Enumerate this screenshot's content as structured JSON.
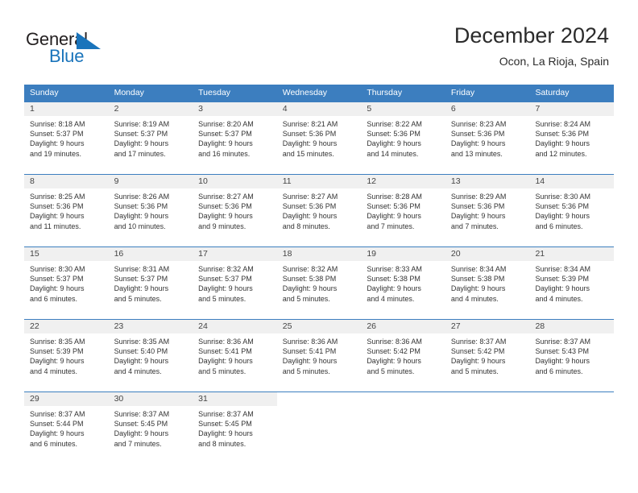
{
  "brand": {
    "name_top": "General",
    "name_bottom": "Blue",
    "flag_icon": "blue-triangle-flag-icon",
    "color_dark": "#231f20",
    "color_blue": "#1a74bb"
  },
  "header": {
    "title": "December 2024",
    "subtitle": "Ocon, La Rioja, Spain"
  },
  "theme": {
    "header_blue": "#3c7ebf",
    "day_band_gray": "#f0f0f0",
    "text_dark": "#333333"
  },
  "weekdays": [
    "Sunday",
    "Monday",
    "Tuesday",
    "Wednesday",
    "Thursday",
    "Friday",
    "Saturday"
  ],
  "weeks": [
    [
      {
        "day": "1",
        "sunrise": "Sunrise: 8:18 AM",
        "sunset": "Sunset: 5:37 PM",
        "daylight1": "Daylight: 9 hours",
        "daylight2": "and 19 minutes."
      },
      {
        "day": "2",
        "sunrise": "Sunrise: 8:19 AM",
        "sunset": "Sunset: 5:37 PM",
        "daylight1": "Daylight: 9 hours",
        "daylight2": "and 17 minutes."
      },
      {
        "day": "3",
        "sunrise": "Sunrise: 8:20 AM",
        "sunset": "Sunset: 5:37 PM",
        "daylight1": "Daylight: 9 hours",
        "daylight2": "and 16 minutes."
      },
      {
        "day": "4",
        "sunrise": "Sunrise: 8:21 AM",
        "sunset": "Sunset: 5:36 PM",
        "daylight1": "Daylight: 9 hours",
        "daylight2": "and 15 minutes."
      },
      {
        "day": "5",
        "sunrise": "Sunrise: 8:22 AM",
        "sunset": "Sunset: 5:36 PM",
        "daylight1": "Daylight: 9 hours",
        "daylight2": "and 14 minutes."
      },
      {
        "day": "6",
        "sunrise": "Sunrise: 8:23 AM",
        "sunset": "Sunset: 5:36 PM",
        "daylight1": "Daylight: 9 hours",
        "daylight2": "and 13 minutes."
      },
      {
        "day": "7",
        "sunrise": "Sunrise: 8:24 AM",
        "sunset": "Sunset: 5:36 PM",
        "daylight1": "Daylight: 9 hours",
        "daylight2": "and 12 minutes."
      }
    ],
    [
      {
        "day": "8",
        "sunrise": "Sunrise: 8:25 AM",
        "sunset": "Sunset: 5:36 PM",
        "daylight1": "Daylight: 9 hours",
        "daylight2": "and 11 minutes."
      },
      {
        "day": "9",
        "sunrise": "Sunrise: 8:26 AM",
        "sunset": "Sunset: 5:36 PM",
        "daylight1": "Daylight: 9 hours",
        "daylight2": "and 10 minutes."
      },
      {
        "day": "10",
        "sunrise": "Sunrise: 8:27 AM",
        "sunset": "Sunset: 5:36 PM",
        "daylight1": "Daylight: 9 hours",
        "daylight2": "and 9 minutes."
      },
      {
        "day": "11",
        "sunrise": "Sunrise: 8:27 AM",
        "sunset": "Sunset: 5:36 PM",
        "daylight1": "Daylight: 9 hours",
        "daylight2": "and 8 minutes."
      },
      {
        "day": "12",
        "sunrise": "Sunrise: 8:28 AM",
        "sunset": "Sunset: 5:36 PM",
        "daylight1": "Daylight: 9 hours",
        "daylight2": "and 7 minutes."
      },
      {
        "day": "13",
        "sunrise": "Sunrise: 8:29 AM",
        "sunset": "Sunset: 5:36 PM",
        "daylight1": "Daylight: 9 hours",
        "daylight2": "and 7 minutes."
      },
      {
        "day": "14",
        "sunrise": "Sunrise: 8:30 AM",
        "sunset": "Sunset: 5:36 PM",
        "daylight1": "Daylight: 9 hours",
        "daylight2": "and 6 minutes."
      }
    ],
    [
      {
        "day": "15",
        "sunrise": "Sunrise: 8:30 AM",
        "sunset": "Sunset: 5:37 PM",
        "daylight1": "Daylight: 9 hours",
        "daylight2": "and 6 minutes."
      },
      {
        "day": "16",
        "sunrise": "Sunrise: 8:31 AM",
        "sunset": "Sunset: 5:37 PM",
        "daylight1": "Daylight: 9 hours",
        "daylight2": "and 5 minutes."
      },
      {
        "day": "17",
        "sunrise": "Sunrise: 8:32 AM",
        "sunset": "Sunset: 5:37 PM",
        "daylight1": "Daylight: 9 hours",
        "daylight2": "and 5 minutes."
      },
      {
        "day": "18",
        "sunrise": "Sunrise: 8:32 AM",
        "sunset": "Sunset: 5:38 PM",
        "daylight1": "Daylight: 9 hours",
        "daylight2": "and 5 minutes."
      },
      {
        "day": "19",
        "sunrise": "Sunrise: 8:33 AM",
        "sunset": "Sunset: 5:38 PM",
        "daylight1": "Daylight: 9 hours",
        "daylight2": "and 4 minutes."
      },
      {
        "day": "20",
        "sunrise": "Sunrise: 8:34 AM",
        "sunset": "Sunset: 5:38 PM",
        "daylight1": "Daylight: 9 hours",
        "daylight2": "and 4 minutes."
      },
      {
        "day": "21",
        "sunrise": "Sunrise: 8:34 AM",
        "sunset": "Sunset: 5:39 PM",
        "daylight1": "Daylight: 9 hours",
        "daylight2": "and 4 minutes."
      }
    ],
    [
      {
        "day": "22",
        "sunrise": "Sunrise: 8:35 AM",
        "sunset": "Sunset: 5:39 PM",
        "daylight1": "Daylight: 9 hours",
        "daylight2": "and 4 minutes."
      },
      {
        "day": "23",
        "sunrise": "Sunrise: 8:35 AM",
        "sunset": "Sunset: 5:40 PM",
        "daylight1": "Daylight: 9 hours",
        "daylight2": "and 4 minutes."
      },
      {
        "day": "24",
        "sunrise": "Sunrise: 8:36 AM",
        "sunset": "Sunset: 5:41 PM",
        "daylight1": "Daylight: 9 hours",
        "daylight2": "and 5 minutes."
      },
      {
        "day": "25",
        "sunrise": "Sunrise: 8:36 AM",
        "sunset": "Sunset: 5:41 PM",
        "daylight1": "Daylight: 9 hours",
        "daylight2": "and 5 minutes."
      },
      {
        "day": "26",
        "sunrise": "Sunrise: 8:36 AM",
        "sunset": "Sunset: 5:42 PM",
        "daylight1": "Daylight: 9 hours",
        "daylight2": "and 5 minutes."
      },
      {
        "day": "27",
        "sunrise": "Sunrise: 8:37 AM",
        "sunset": "Sunset: 5:42 PM",
        "daylight1": "Daylight: 9 hours",
        "daylight2": "and 5 minutes."
      },
      {
        "day": "28",
        "sunrise": "Sunrise: 8:37 AM",
        "sunset": "Sunset: 5:43 PM",
        "daylight1": "Daylight: 9 hours",
        "daylight2": "and 6 minutes."
      }
    ],
    [
      {
        "day": "29",
        "sunrise": "Sunrise: 8:37 AM",
        "sunset": "Sunset: 5:44 PM",
        "daylight1": "Daylight: 9 hours",
        "daylight2": "and 6 minutes."
      },
      {
        "day": "30",
        "sunrise": "Sunrise: 8:37 AM",
        "sunset": "Sunset: 5:45 PM",
        "daylight1": "Daylight: 9 hours",
        "daylight2": "and 7 minutes."
      },
      {
        "day": "31",
        "sunrise": "Sunrise: 8:37 AM",
        "sunset": "Sunset: 5:45 PM",
        "daylight1": "Daylight: 9 hours",
        "daylight2": "and 8 minutes."
      },
      {
        "day": "",
        "sunrise": "",
        "sunset": "",
        "daylight1": "",
        "daylight2": ""
      },
      {
        "day": "",
        "sunrise": "",
        "sunset": "",
        "daylight1": "",
        "daylight2": ""
      },
      {
        "day": "",
        "sunrise": "",
        "sunset": "",
        "daylight1": "",
        "daylight2": ""
      },
      {
        "day": "",
        "sunrise": "",
        "sunset": "",
        "daylight1": "",
        "daylight2": ""
      }
    ]
  ]
}
